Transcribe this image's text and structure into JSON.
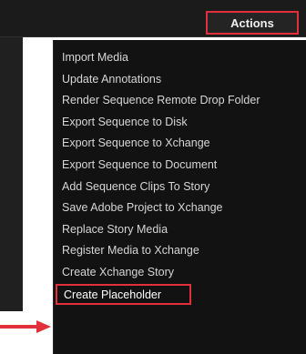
{
  "header": {
    "actions_label": "Actions"
  },
  "menu": {
    "items": [
      {
        "label": "Import Media"
      },
      {
        "label": "Update Annotations"
      },
      {
        "label": "Render Sequence Remote Drop Folder"
      },
      {
        "label": "Export Sequence to Disk"
      },
      {
        "label": "Export Sequence to Xchange"
      },
      {
        "label": "Export Sequence to Document"
      },
      {
        "label": "Add Sequence Clips To Story"
      },
      {
        "label": "Save Adobe Project to Xchange"
      },
      {
        "label": "Replace Story Media"
      },
      {
        "label": "Register Media to Xchange"
      },
      {
        "label": "Create Xchange Story"
      },
      {
        "label": "Create Placeholder"
      }
    ]
  },
  "colors": {
    "highlight": "#e2303a",
    "menu_bg": "#121212",
    "text": "#d6d6d6"
  },
  "icons": {
    "pointer": "arrow-right-icon"
  }
}
